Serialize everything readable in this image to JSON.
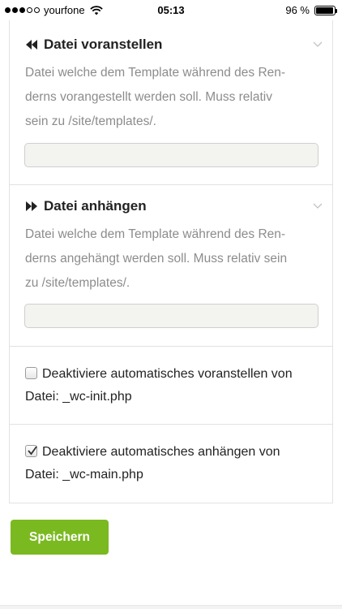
{
  "status_bar": {
    "carrier": "yourfone",
    "time": "05:13",
    "battery_text": "96 %",
    "battery_level": 0.96
  },
  "sections": [
    {
      "title": "Datei voranstellen",
      "icon": "fast-backward-icon",
      "description_lines": [
        "Datei welche dem Template während des Ren-",
        "derns vorangestellt werden soll. Muss relativ",
        "sein zu /site/templates/."
      ],
      "input_value": ""
    },
    {
      "title": "Datei anhängen",
      "icon": "fast-forward-icon",
      "description_lines": [
        "Datei welche dem Template während des Ren-",
        "derns angehängt werden soll. Muss relativ sein",
        "zu /site/templates/."
      ],
      "input_value": ""
    }
  ],
  "checkboxes": [
    {
      "line1": "Deaktiviere automatisches voranstellen von",
      "line2": "Datei: _wc-init.php",
      "checked": false
    },
    {
      "line1": "Deaktiviere automatisches anhängen von",
      "line2": "Datei: _wc-main.php",
      "checked": true
    }
  ],
  "save_button": {
    "label": "Speichern"
  },
  "colors": {
    "accent": "#7bb921",
    "description": "#8c8c8c",
    "border": "#e2e2e2"
  }
}
